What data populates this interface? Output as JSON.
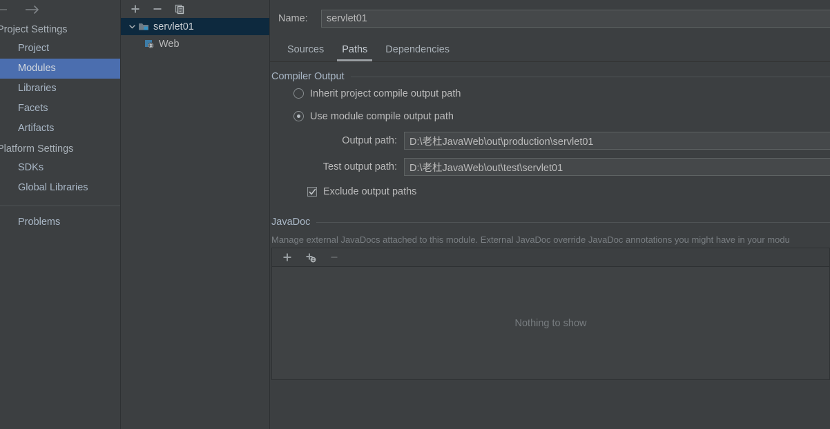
{
  "sidebar": {
    "nav": {
      "back_icon": "arrow-left-icon",
      "forward_icon": "arrow-right-icon"
    },
    "groups": [
      {
        "title": "Project Settings",
        "items": [
          {
            "label": "Project",
            "selected": false
          },
          {
            "label": "Modules",
            "selected": true
          },
          {
            "label": "Libraries",
            "selected": false
          },
          {
            "label": "Facets",
            "selected": false
          },
          {
            "label": "Artifacts",
            "selected": false
          }
        ]
      },
      {
        "title": "Platform Settings",
        "items": [
          {
            "label": "SDKs",
            "selected": false
          },
          {
            "label": "Global Libraries",
            "selected": false
          }
        ]
      }
    ],
    "problems": {
      "label": "Problems"
    }
  },
  "tree": {
    "toolbar": [
      {
        "name": "add-module-button",
        "icon": "plus-icon"
      },
      {
        "name": "remove-module-button",
        "icon": "minus-icon"
      },
      {
        "name": "copy-module-button",
        "icon": "copy-icon"
      }
    ],
    "nodes": [
      {
        "label": "servlet01",
        "icon": "module-folder-icon",
        "selected": true,
        "expanded": true,
        "depth": 0
      },
      {
        "label": "Web",
        "icon": "web-facet-icon",
        "selected": false,
        "depth": 1
      }
    ]
  },
  "main": {
    "name_label": "Name:",
    "name_value": "servlet01",
    "tabs": [
      {
        "label": "Sources",
        "active": false
      },
      {
        "label": "Paths",
        "active": true
      },
      {
        "label": "Dependencies",
        "active": false
      }
    ],
    "compiler_output": {
      "section_title": "Compiler Output",
      "inherit_option": "Inherit project compile output path",
      "inherit_selected": false,
      "module_option": "Use module compile output path",
      "module_selected": true,
      "output_path_label": "Output path:",
      "output_path_value": "D:\\老杜JavaWeb\\out\\production\\servlet01",
      "test_output_path_label": "Test output path:",
      "test_output_path_value": "D:\\老杜JavaWeb\\out\\test\\servlet01",
      "exclude_label": "Exclude output paths",
      "exclude_checked": true
    },
    "javadoc": {
      "section_title": "JavaDoc",
      "description": "Manage external JavaDocs attached to this module. External JavaDoc override JavaDoc annotations you might have in your modu",
      "toolbar": [
        {
          "name": "add-javadoc-path-button",
          "icon": "plus-icon",
          "enabled": true
        },
        {
          "name": "add-javadoc-url-button",
          "icon": "plus-globe-icon",
          "enabled": true
        },
        {
          "name": "remove-javadoc-button",
          "icon": "minus-icon",
          "enabled": false
        }
      ],
      "empty_text": "Nothing to show"
    }
  },
  "colors": {
    "background": "#3c3f41",
    "selection_blue": "#4b6eaf",
    "tree_selection": "#0d293e",
    "text": "#bbbbbb",
    "muted_text": "#7a7f83",
    "border": "#2e3133",
    "icon_blue": "#3592c4"
  }
}
